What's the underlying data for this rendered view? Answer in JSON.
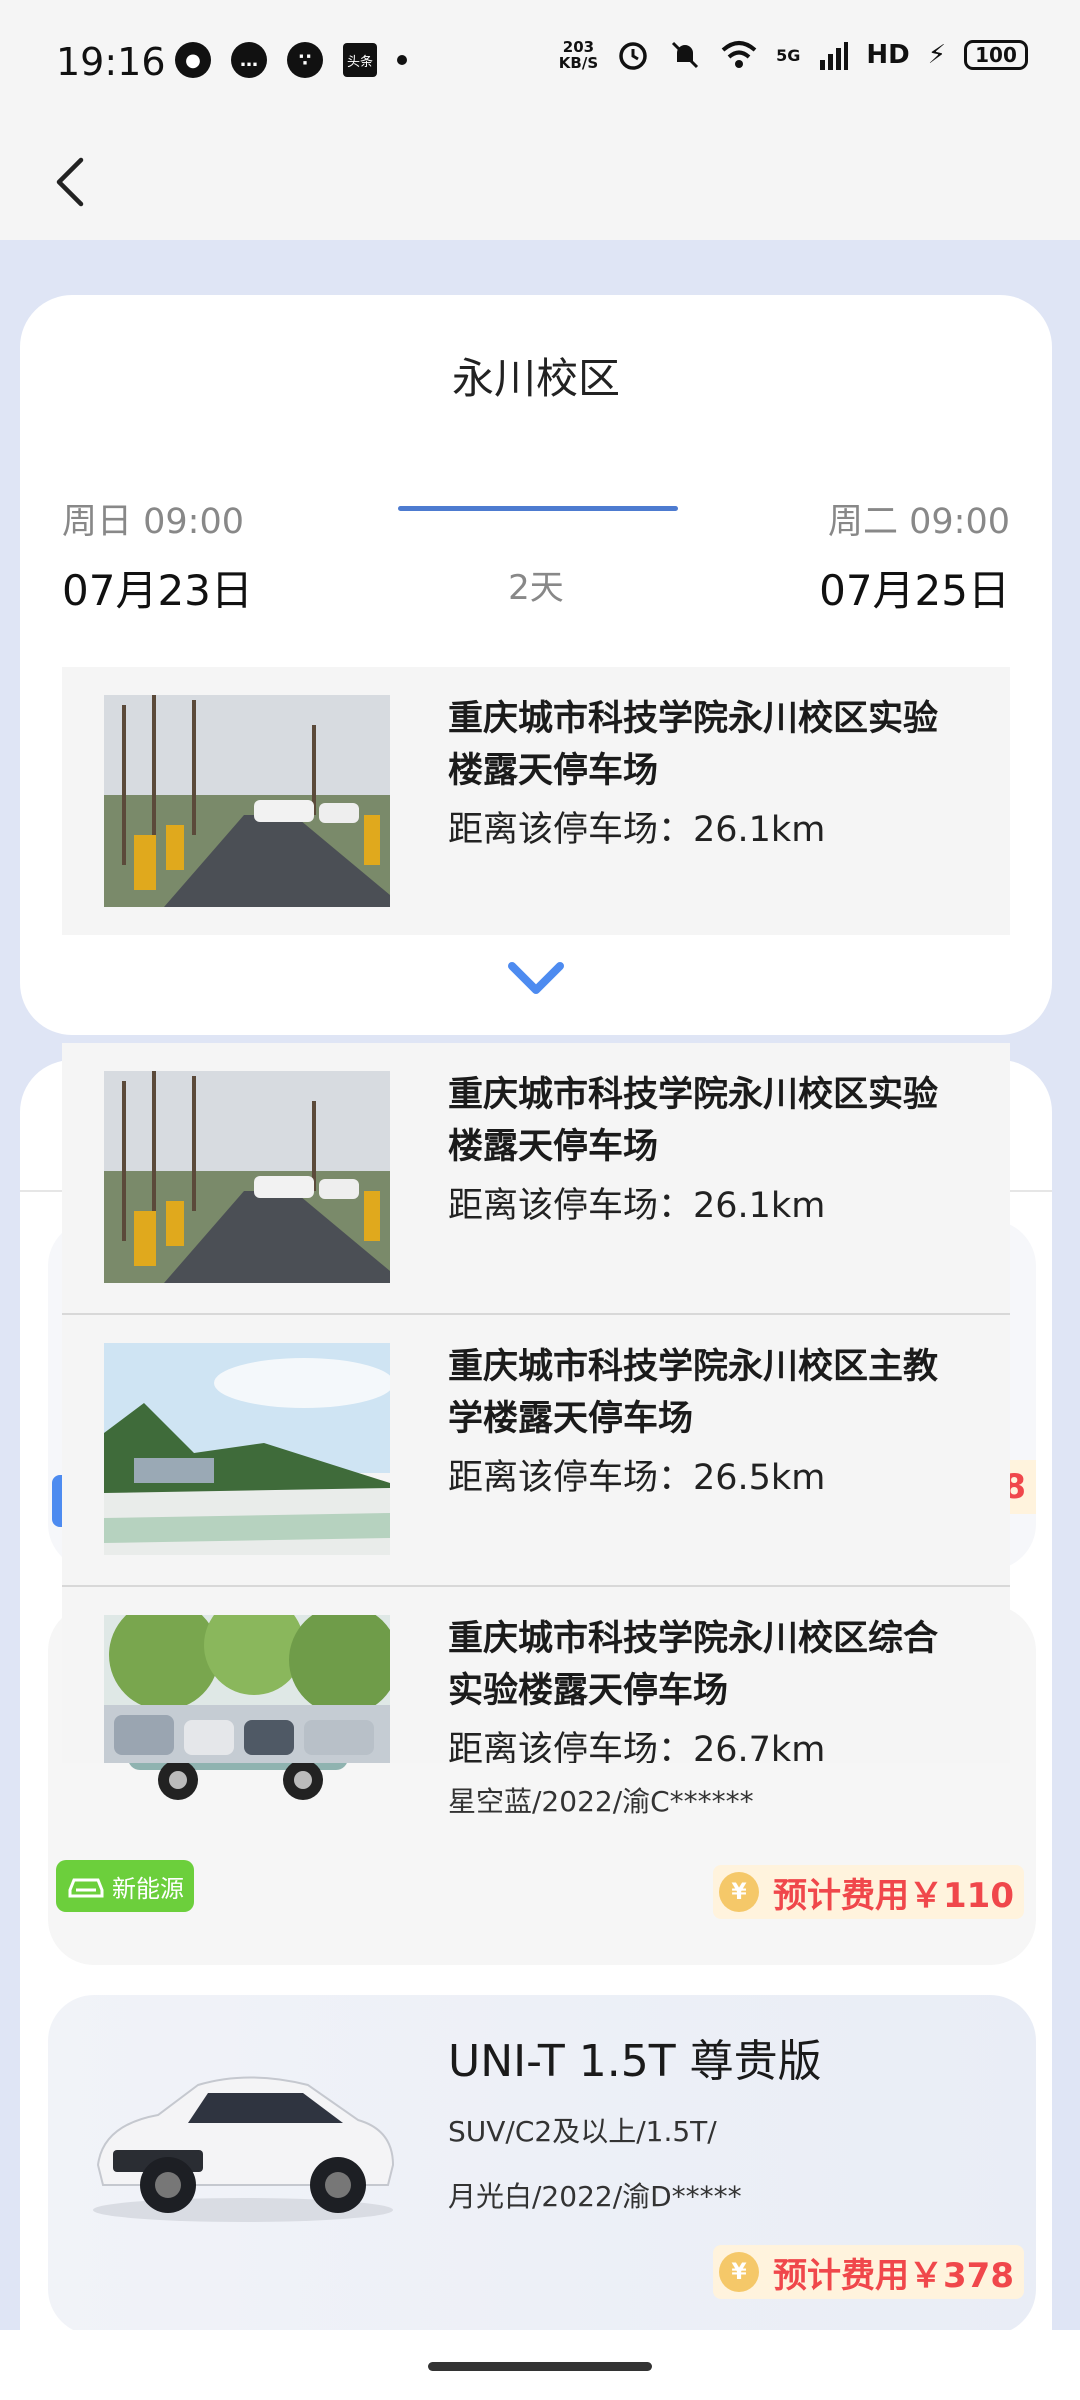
{
  "status_bar": {
    "time": "19:16",
    "net_speed_top": "203",
    "net_speed_bottom": "KB/S",
    "network": "5G",
    "hd": "HD",
    "battery": "100",
    "news_icon_text": "头条"
  },
  "header": {
    "campus": "永川校区",
    "start_day": "周日 09:00",
    "start_date": "07月23日",
    "end_day": "周二 09:00",
    "end_date": "07月25日",
    "duration": "2天"
  },
  "selected_lot": {
    "name": "重庆城市科技学院永川校区实验楼露天停车场",
    "distance": "距离该停车场：26.1km"
  },
  "lot_options": [
    {
      "name": "重庆城市科技学院永川校区实验楼露天停车场",
      "distance": "距离该停车场：26.1km"
    },
    {
      "name": "重庆城市科技学院永川校区主教学楼露天停车场",
      "distance": "距离该停车场：26.5km"
    },
    {
      "name": "重庆城市科技学院永川校区综合实验楼露天停车场",
      "distance": "距离该停车场：26.7km"
    }
  ],
  "cars": [
    {
      "fee_partial": "8"
    },
    {
      "spec2": "星空蓝/2022/渝C******",
      "badge": "新能源",
      "fee": "预计费用￥110"
    },
    {
      "name": "UNI-T 1.5T 尊贵版",
      "spec1": "SUV/C2及以上/1.5T/",
      "spec2": "月光白/2022/渝D*****",
      "fee": "预计费用￥378"
    }
  ],
  "colors": {
    "accent_blue": "#4d7bd0",
    "fee_red": "#f0474b",
    "ev_green": "#6ccf3c",
    "page_bg": "#dfe5f5"
  }
}
